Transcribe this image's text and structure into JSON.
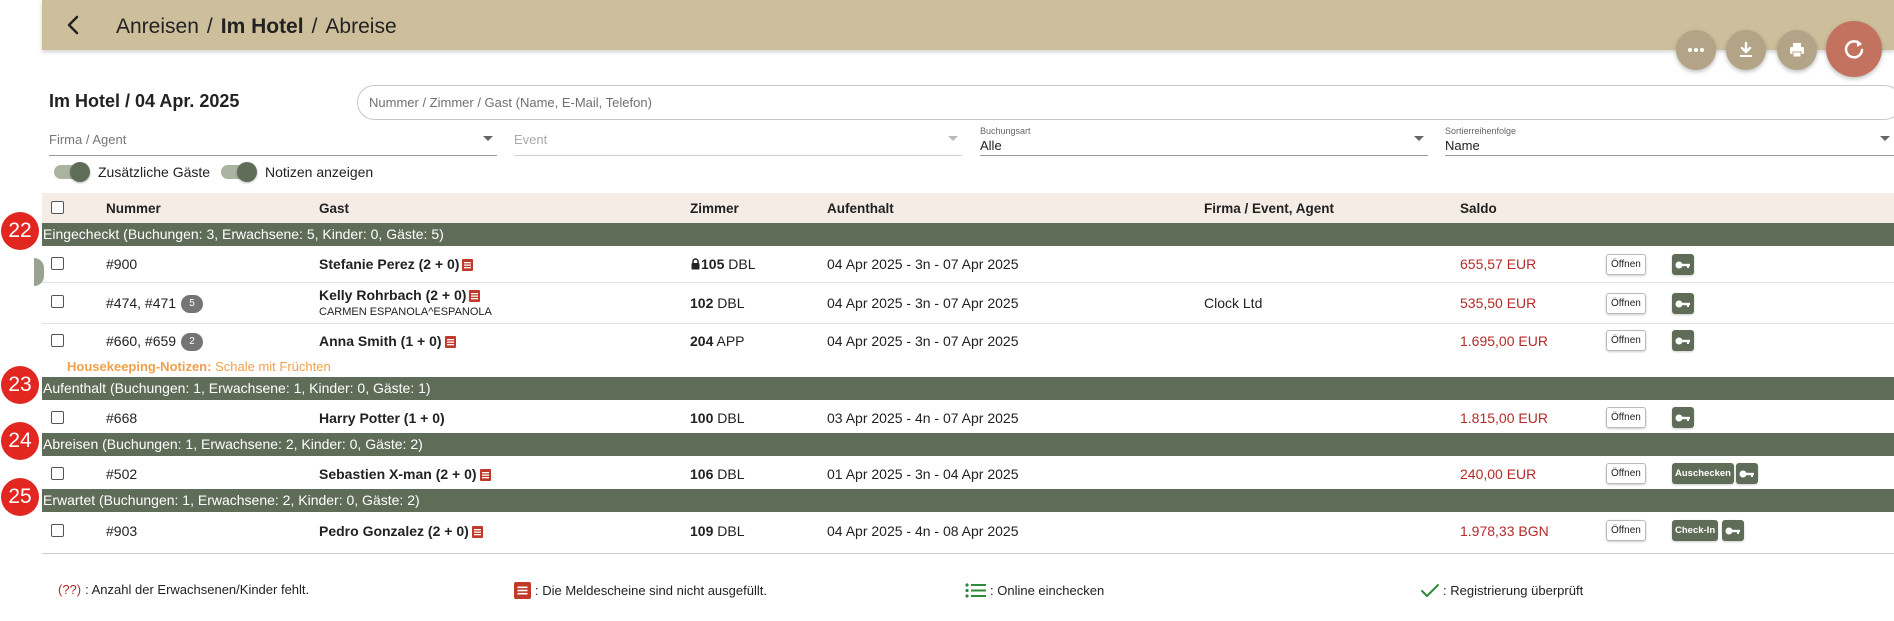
{
  "header": {
    "breadcrumbs": [
      {
        "label": "Anreisen",
        "active": false
      },
      {
        "label": "Im Hotel",
        "active": true
      },
      {
        "label": "Abreise",
        "active": false
      }
    ],
    "separator": "/"
  },
  "page": {
    "title": "Im Hotel / 04 Apr. 2025"
  },
  "search": {
    "placeholder": "Nummer / Zimmer / Gast (Name, E-Mail, Telefon)"
  },
  "filters": {
    "company": {
      "placeholder": "Firma / Agent"
    },
    "event": {
      "placeholder": "Event"
    },
    "booking_type": {
      "label": "Buchungsart",
      "value": "Alle"
    },
    "sort": {
      "label": "Sortierreihenfolge",
      "value": "Name"
    }
  },
  "toggles": {
    "extra_guests": {
      "label": "Zusätzliche Gäste",
      "on": true
    },
    "show_notes": {
      "label": "Notizen anzeigen",
      "on": true
    }
  },
  "columns": {
    "number": "Nummer",
    "guest": "Gast",
    "room": "Zimmer",
    "stay": "Aufenthalt",
    "company": "Firma / Event, Agent",
    "balance": "Saldo"
  },
  "groups": [
    {
      "badge": "22",
      "label": "Eingecheckt (Buchungen: 3, Erwachsene: 5, Kinder: 0, Gäste: 5)"
    },
    {
      "badge": "23",
      "label": "Aufenthalt (Buchungen: 1, Erwachsene: 1, Kinder: 0, Gäste: 1)"
    },
    {
      "badge": "24",
      "label": "Abreisen (Buchungen: 1, Erwachsene: 2, Kinder: 0, Gäste: 2)"
    },
    {
      "badge": "25",
      "label": "Erwartet (Buchungen: 1, Erwachsene: 2, Kinder: 0, Gäste: 2)"
    }
  ],
  "rows": [
    {
      "number": "#900",
      "count": "",
      "guest": "Stefanie Perez (2 + 0)",
      "sub": "",
      "room_no": "105",
      "room_type": "DBL",
      "locked": true,
      "stay": "04 Apr 2025 - 3n - 07 Apr 2025",
      "company": "",
      "balance": "655,57 EUR"
    },
    {
      "number": "#474, #471",
      "count": "5",
      "guest": "Kelly Rohrbach (2 + 0)",
      "sub": "CARMEN ESPANOLA^ESPANOLA",
      "room_no": "102",
      "room_type": "DBL",
      "locked": false,
      "stay": "04 Apr 2025 - 3n - 07 Apr 2025",
      "company": "Clock Ltd",
      "balance": "535,50 EUR"
    },
    {
      "number": "#660, #659",
      "count": "2",
      "guest": "Anna Smith (1 + 0)",
      "sub": "",
      "room_no": "204",
      "room_type": "APP",
      "locked": false,
      "stay": "04 Apr 2025 - 3n - 07 Apr 2025",
      "company": "",
      "balance": "1.695,00 EUR"
    },
    {
      "number": "#668",
      "count": "",
      "guest": "Harry Potter (1 + 0)",
      "sub": "",
      "room_no": "100",
      "room_type": "DBL",
      "locked": false,
      "stay": "03 Apr 2025 - 4n - 07 Apr 2025",
      "company": "",
      "balance": "1.815,00 EUR"
    },
    {
      "number": "#502",
      "count": "",
      "guest": "Sebastien X-man (2 + 0)",
      "sub": "",
      "room_no": "106",
      "room_type": "DBL",
      "locked": false,
      "stay": "01 Apr 2025 - 3n - 04 Apr 2025",
      "company": "",
      "balance": "240,00 EUR"
    },
    {
      "number": "#903",
      "count": "",
      "guest": "Pedro Gonzalez (2 + 0)",
      "sub": "",
      "room_no": "109",
      "room_type": "DBL",
      "locked": false,
      "stay": "04 Apr 2025 - 4n - 08 Apr 2025",
      "company": "",
      "balance": "1.978,33 BGN"
    }
  ],
  "note": {
    "label": "Housekeeping-Notizen:",
    "text": "Schale mit Früchten"
  },
  "actions": {
    "open": "Öffnen",
    "checkout": "Auschecken",
    "checkin": "Check-In"
  },
  "legend": {
    "missing_marker": "(??)",
    "missing_text": ": Anzahl der Erwachsenen/Kinder fehlt.",
    "forms_text": ": Die Meldescheine sind nicht ausgefüllt.",
    "online_text": ": Online einchecken",
    "verified_text": ": Registrierung überprüft"
  },
  "colors": {
    "header": "#cdbf9c",
    "group_bar": "#5f6c58",
    "balance": "#b52a2a",
    "badge": "#e22620",
    "note": "#f0a04b",
    "refresh_fab": "#c47260"
  }
}
